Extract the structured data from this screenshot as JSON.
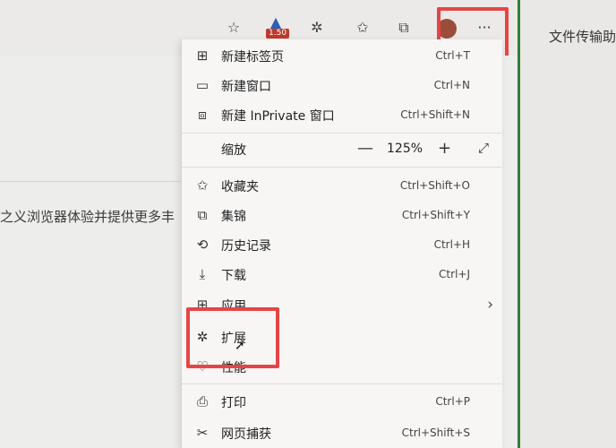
{
  "toolbar": {
    "badge": "1.50",
    "more_label": "···",
    "icons": [
      "favorite-add-icon",
      "media-icon",
      "extensions-icon",
      "favorites-icon",
      "collections-icon",
      "avatar",
      "more-icon"
    ]
  },
  "page": {
    "body_text": "之义浏览器体验并提供更多丰"
  },
  "side_panel": {
    "title": "文件传输助"
  },
  "menu": {
    "items": [
      {
        "label": "新建标签页",
        "shortcut": "Ctrl+T"
      },
      {
        "label": "新建窗口",
        "shortcut": "Ctrl+N"
      },
      {
        "label": "新建 InPrivate 窗口",
        "shortcut": "Ctrl+Shift+N"
      },
      {
        "label": "缩放",
        "zoom_value": "125%"
      },
      {
        "label": "收藏夹",
        "shortcut": "Ctrl+Shift+O"
      },
      {
        "label": "集锦",
        "shortcut": "Ctrl+Shift+Y"
      },
      {
        "label": "历史记录",
        "shortcut": "Ctrl+H"
      },
      {
        "label": "下载",
        "shortcut": "Ctrl+J"
      },
      {
        "label": "应用"
      },
      {
        "label": "扩展"
      },
      {
        "label": "性能"
      },
      {
        "label": "打印",
        "shortcut": "Ctrl+P"
      },
      {
        "label": "网页捕获",
        "shortcut": "Ctrl+Shift+S"
      }
    ]
  },
  "colors": {
    "highlight": "#e64545",
    "panel_border": "#2f7d3a",
    "badge": "#c0392b"
  }
}
